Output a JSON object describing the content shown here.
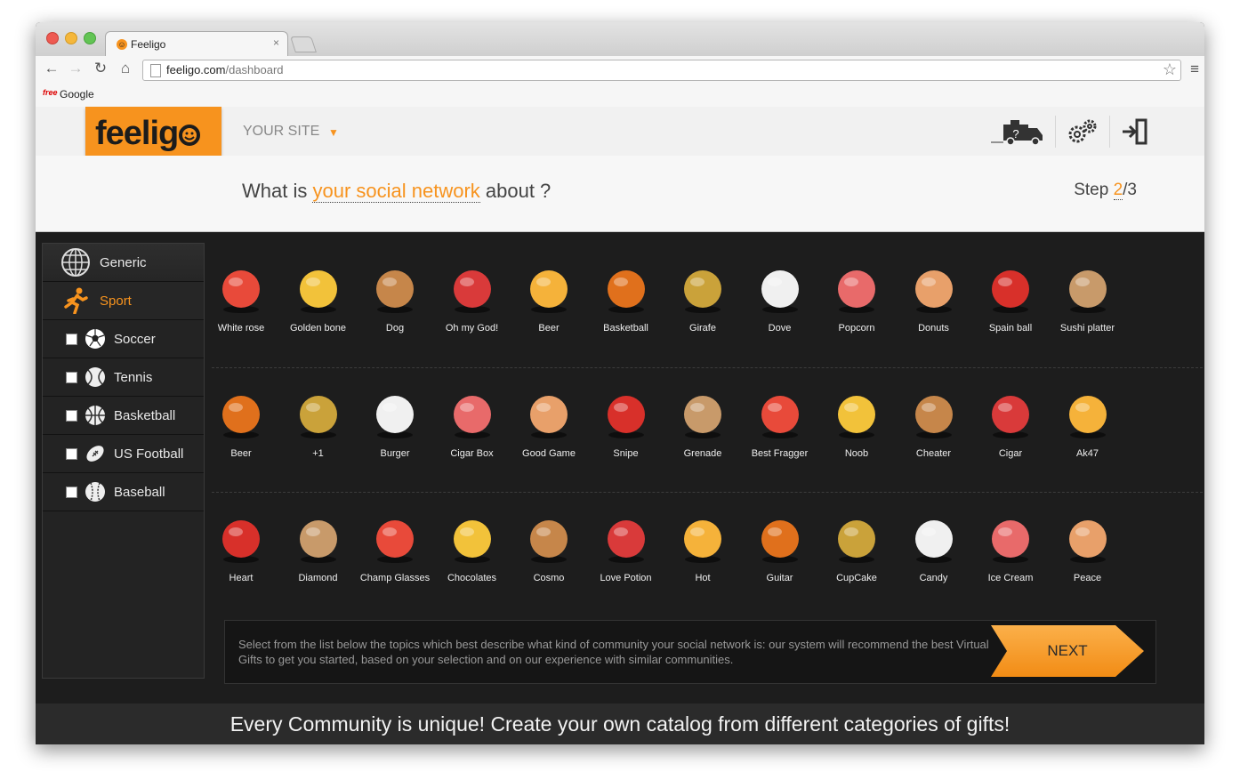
{
  "browser": {
    "tab_title": "Feeligo",
    "tab_close": "×",
    "url_domain": "feeligo.com",
    "url_path": "/dashboard",
    "bookmark_icon": "free",
    "bookmark_label": "Google"
  },
  "header": {
    "logo_text": "feelig",
    "site_label": "YOUR SITE",
    "site_caret": "▼",
    "icons": [
      "help-truck-icon",
      "settings-gears-icon",
      "logout-icon"
    ]
  },
  "question": {
    "prefix": "What is ",
    "accent": "your social network",
    "suffix": " about ?",
    "step_prefix": "Step ",
    "step_current": "2",
    "step_total": "/3"
  },
  "sidebar": {
    "items": [
      {
        "label": "Generic",
        "icon": "globe-icon"
      },
      {
        "label": "Sport",
        "icon": "runner-icon"
      },
      {
        "label": "Soccer",
        "icon": "soccer-ball-icon"
      },
      {
        "label": "Tennis",
        "icon": "tennis-ball-icon"
      },
      {
        "label": "Basketball",
        "icon": "basketball-icon"
      },
      {
        "label": "US Football",
        "icon": "us-football-icon"
      },
      {
        "label": "Baseball",
        "icon": "baseball-icon"
      }
    ]
  },
  "gifts": [
    [
      "White rose",
      "Golden bone",
      "Dog",
      "Oh my God!",
      "Beer",
      "Basketball",
      "Girafe",
      "Dove",
      "Popcorn",
      "Donuts",
      "Spain ball",
      "Sushi platter"
    ],
    [
      "Beer",
      "+1",
      "Burger",
      "Cigar Box",
      "Good Game",
      "Snipe",
      "Grenade",
      "Best Fragger",
      "Noob",
      "Cheater",
      "Cigar",
      "Ak47"
    ],
    [
      "Heart",
      "Diamond",
      "Champ Glasses",
      "Chocolates",
      "Cosmo",
      "Love Potion",
      "Hot",
      "Guitar",
      "CupCake",
      "Candy",
      "Ice Cream",
      "Peace"
    ]
  ],
  "info": {
    "text": "Select from the list below the topics which best describe what kind of community your social network is: our system will recommend the best Virtual Gifts to get you started, based on your selection and on our experience with similar communities.",
    "next_label": "NEXT"
  },
  "footer": {
    "text": "Every Community is unique! Create your own catalog from different categories of gifts!"
  },
  "colors": {
    "accent": "#f7931e",
    "page_bg": "#1d1d1d"
  }
}
